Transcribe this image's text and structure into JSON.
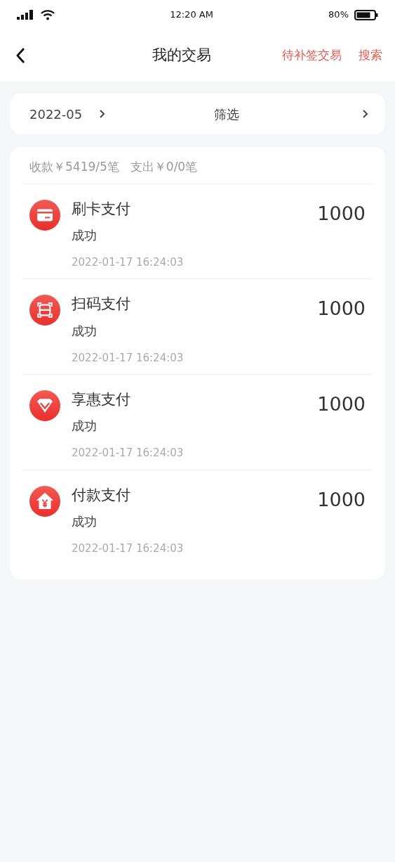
{
  "status_bar": {
    "time": "12:20 AM",
    "battery": "80%"
  },
  "nav": {
    "title": "我的交易",
    "actions": [
      "待补签交易",
      "搜索"
    ]
  },
  "filter": {
    "month": "2022-05",
    "label": "筛选"
  },
  "summary": {
    "income": "收款￥5419/5笔",
    "expense": "支出￥0/0笔"
  },
  "transactions": [
    {
      "kind": "card",
      "title": "刷卡支付",
      "status": "成功",
      "time": "2022-01-17 16:24:03",
      "amount": "1000"
    },
    {
      "kind": "scan",
      "title": "扫码支付",
      "status": "成功",
      "time": "2022-01-17 16:24:03",
      "amount": "1000"
    },
    {
      "kind": "discount",
      "title": "享惠支付",
      "status": "成功",
      "time": "2022-01-17 16:24:03",
      "amount": "1000"
    },
    {
      "kind": "payment",
      "title": "付款支付",
      "status": "成功",
      "time": "2022-01-17 16:24:03",
      "amount": "1000"
    }
  ]
}
